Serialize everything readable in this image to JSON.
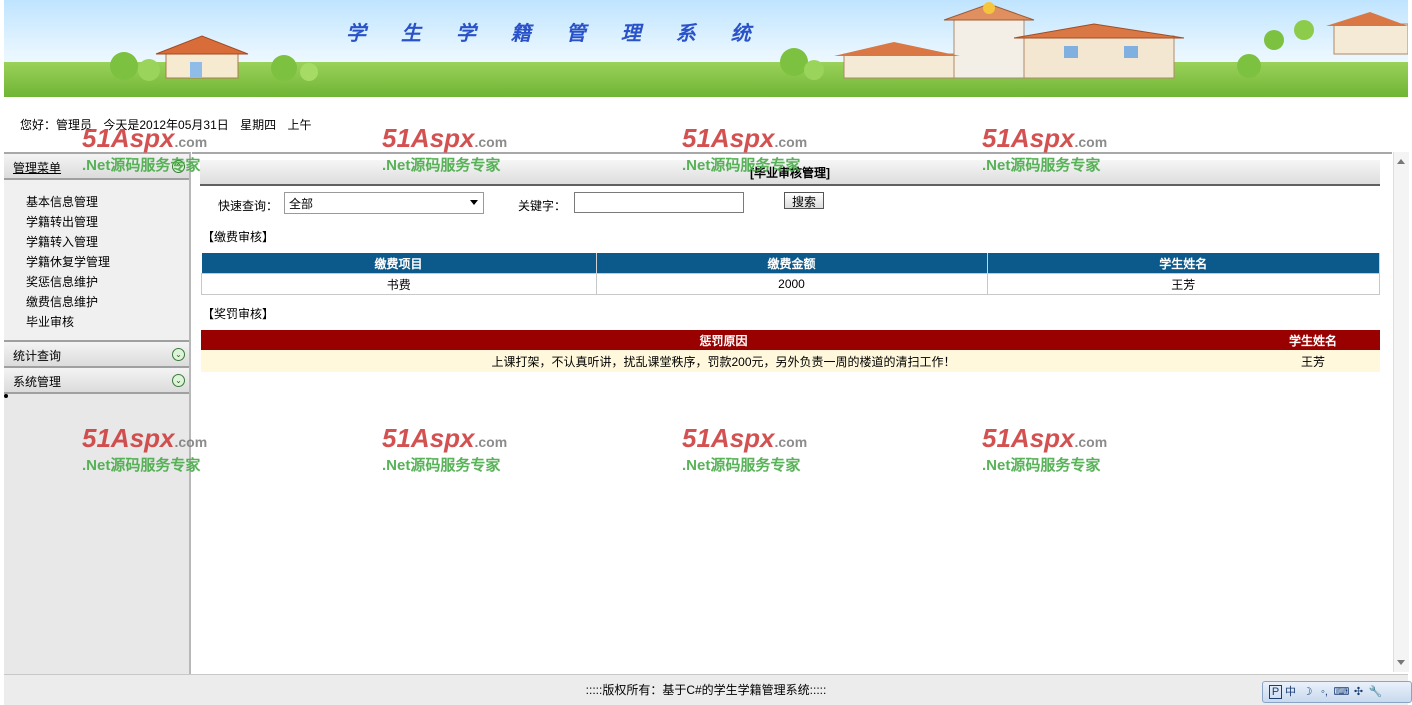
{
  "banner": {
    "title": "学 生 学 籍 管 理 系 统"
  },
  "greeting": {
    "hello": "您好：管理员",
    "date": "今天是2012年05月31日",
    "weekday": "星期四",
    "period": "上午"
  },
  "sidebar": {
    "menu_head": "管理菜单",
    "items": [
      "基本信息管理",
      "学籍转出管理",
      "学籍转入管理",
      "学籍休复学管理",
      "奖惩信息维护",
      "缴费信息维护",
      "毕业审核"
    ],
    "stats_head": "统计查询",
    "system_head": "系统管理"
  },
  "main": {
    "title": "[毕业审核管理]",
    "quick_label": "快速查询：",
    "quick_value": "全部",
    "keyword_label": "关键字：",
    "keyword_value": "",
    "search_button": "搜索",
    "fee_section": "【缴费审核】",
    "fee_table": {
      "headers": [
        "缴费项目",
        "缴费金额",
        "学生姓名"
      ],
      "rows": [
        [
          "书费",
          "2000",
          "王芳"
        ]
      ]
    },
    "punish_section": "【奖罚审核】",
    "punish_table": {
      "headers": [
        "惩罚原因",
        "学生姓名"
      ],
      "rows": [
        [
          "上课打架，不认真听讲，扰乱课堂秩序，罚款200元，另外负责一周的楼道的清扫工作！",
          "王芳"
        ]
      ]
    }
  },
  "footer": {
    "text": ":::::版权所有：基于C#的学生学籍管理系统:::::"
  },
  "watermark": {
    "logo": "51Aspx",
    "logo_suffix": ".com",
    "slogan": ".Net源码服务专家"
  },
  "ime": [
    "中",
    "☽",
    "◦,",
    "⌨",
    "✣",
    "🔧"
  ],
  "colors": {
    "fee_header": "#0c5a8c",
    "punish_header": "#990000",
    "punish_row": "#fff8dc"
  }
}
